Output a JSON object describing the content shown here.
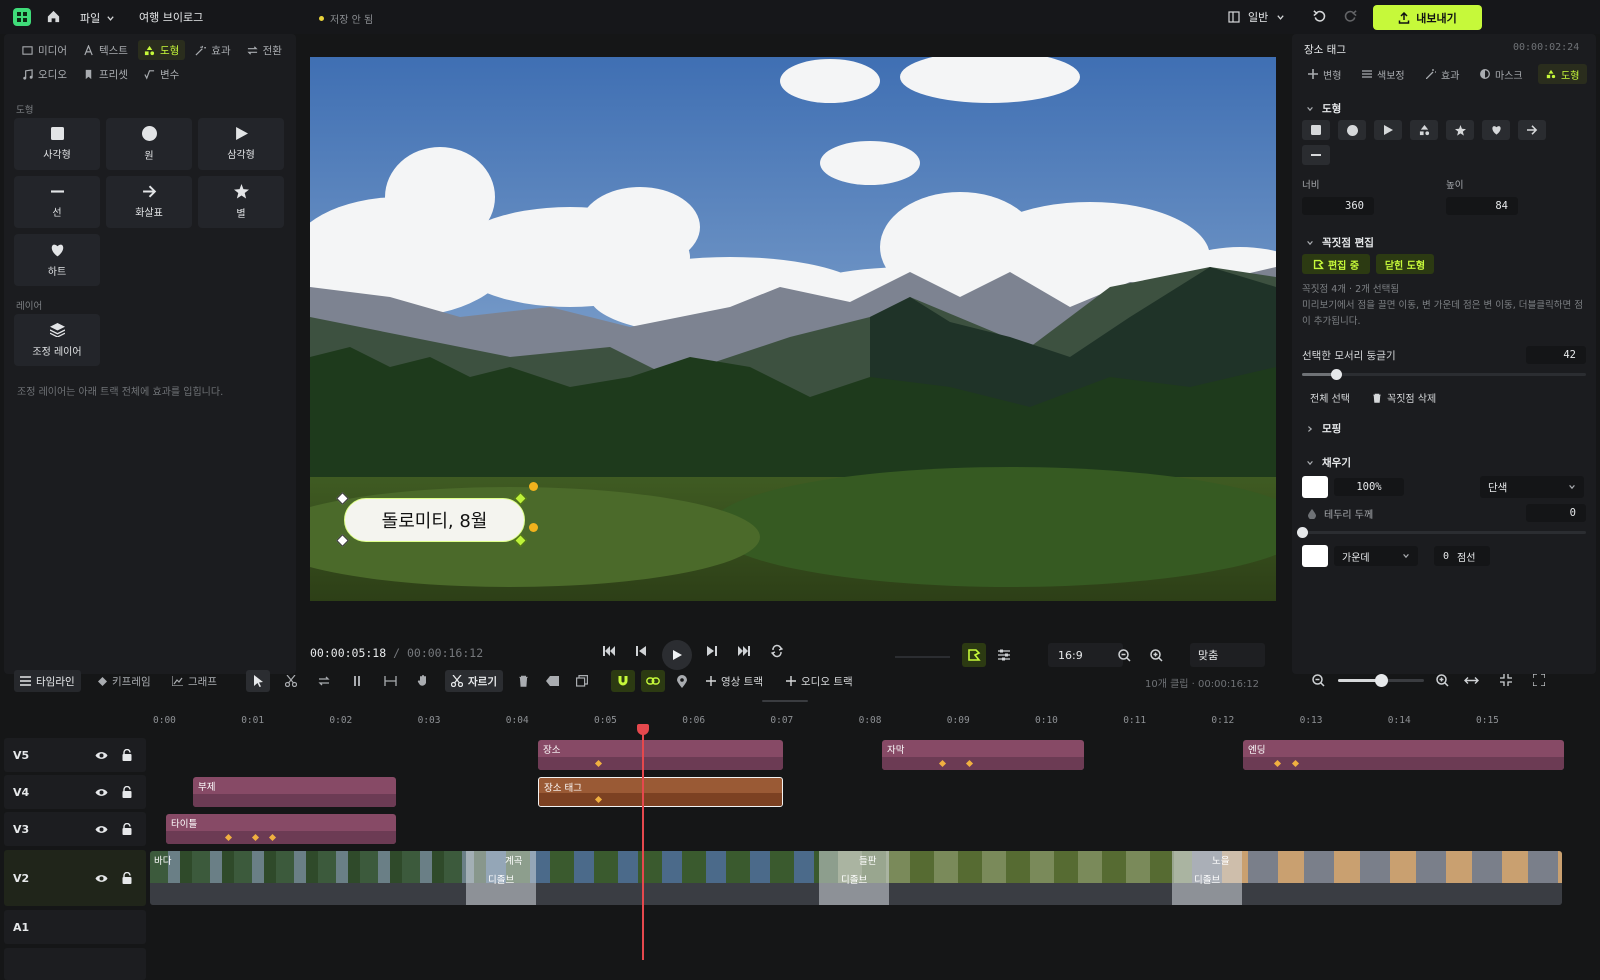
{
  "topbar": {
    "file_menu": "파일",
    "project_name": "여행 브이로그",
    "save_status": "저장 안 됨",
    "view_mode": "일반",
    "export_label": "내보내기"
  },
  "left_panel": {
    "tabs": [
      {
        "label": "미디어",
        "icon": "media-icon"
      },
      {
        "label": "텍스트",
        "icon": "text-icon"
      },
      {
        "label": "도형",
        "icon": "shapes-icon"
      },
      {
        "label": "효과",
        "icon": "effects-icon"
      },
      {
        "label": "전환",
        "icon": "transition-icon"
      },
      {
        "label": "오디오",
        "icon": "audio-icon"
      },
      {
        "label": "프리셋",
        "icon": "preset-icon"
      },
      {
        "label": "변수",
        "icon": "variable-icon"
      }
    ],
    "active_tab": "도형",
    "shapes_heading": "도형",
    "shapes": [
      {
        "label": "사각형",
        "icon": "square-icon"
      },
      {
        "label": "원",
        "icon": "circle-icon"
      },
      {
        "label": "삼각형",
        "icon": "triangle-icon"
      },
      {
        "label": "선",
        "icon": "line-icon"
      },
      {
        "label": "화살표",
        "icon": "arrow-icon"
      },
      {
        "label": "별",
        "icon": "star-icon"
      },
      {
        "label": "하트",
        "icon": "heart-icon"
      }
    ],
    "layers_heading": "레이어",
    "adjustment_layer": "조정 레이어",
    "adjustment_note": "조정 레이어는 아래 트랙 전체에 효과를 입힙니다."
  },
  "preview": {
    "overlay_text": "돌로미티, 8월",
    "current_time": "00:00:05:18",
    "total_time": "00:00:16:12",
    "aspect_ratio": "16:9",
    "zoom_fit": "맞춤"
  },
  "inspector": {
    "title": "장소 태그",
    "duration": "00:00:02:24",
    "tabs": [
      "변형",
      "색보정",
      "효과",
      "마스크",
      "도형"
    ],
    "active_tab": "도형",
    "shape_section": "도형",
    "width_label": "너비",
    "width_value": "360",
    "height_label": "높이",
    "height_value": "84",
    "vertex_section": "꼭짓점 편집",
    "editing_button": "편집 중",
    "closed_shape_button": "닫힌 도형",
    "vertex_info": "꼭짓점 4개 · 2개 선택됨",
    "vertex_help": "미리보기에서 점을 끌면 이동, 변 가운데 점은 변 이동, 더블클릭하면 점이 추가됩니다.",
    "corner_radius_label": "선택한 모서리 둥글기",
    "corner_radius_value": "42",
    "corner_radius_fraction": 0.12,
    "select_all": "전체 선택",
    "delete_vertex": "꼭짓점 삭제",
    "morph_section": "모핑",
    "fill_section": "채우기",
    "fill_color": "#ffffff",
    "fill_opacity": "100%",
    "fill_type": "단색",
    "stroke_label": "테두리 두께",
    "stroke_value": "0",
    "stroke_fraction": 0.0,
    "stroke_align": "가운데",
    "dash_value": "0",
    "dash_label": "점선"
  },
  "timeline_toolbar": {
    "tabs": [
      "타임라인",
      "키프레임",
      "그래프"
    ],
    "active_tab": "타임라인",
    "cut_label": "자르기",
    "add_video_track": "영상 트랙",
    "add_audio_track": "오디오 트랙",
    "summary": "10개 클립 · 00:00:16:12",
    "zoom_fraction": 0.5
  },
  "timeline": {
    "ruler": [
      "0:00",
      "0:01",
      "0:02",
      "0:03",
      "0:04",
      "0:05",
      "0:06",
      "0:07",
      "0:08",
      "0:09",
      "0:10",
      "0:11",
      "0:12",
      "0:13",
      "0:14",
      "0:15"
    ],
    "tracks": [
      "V5",
      "V4",
      "V3",
      "V2",
      "A1"
    ],
    "clips": {
      "v5": [
        "장소",
        "자막",
        "엔딩"
      ],
      "v4": [
        "부제",
        "장소 태그"
      ],
      "v3": [
        "타이틀"
      ],
      "v2": [
        "바다",
        "계곡",
        "들판",
        "노을"
      ],
      "transitions": [
        "디졸브",
        "디졸브",
        "디졸브"
      ]
    }
  },
  "colors": {
    "accent": "#c6f93a",
    "clip_pink": "#874a66",
    "clip_selected": "#a0552c",
    "playhead": "#e5484d"
  }
}
